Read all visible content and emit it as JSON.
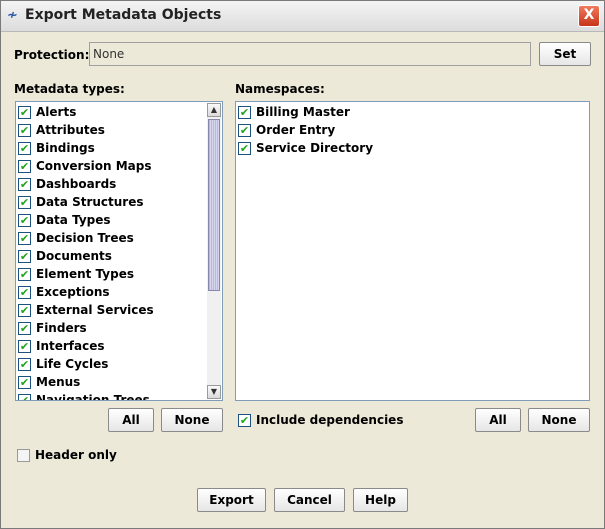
{
  "window": {
    "title": "Export Metadata Objects",
    "close_glyph": "X"
  },
  "protection": {
    "label": "Protection:",
    "value": "None",
    "set_label": "Set"
  },
  "metadata_types": {
    "label": "Metadata types:",
    "items": [
      {
        "label": "Alerts",
        "checked": true
      },
      {
        "label": "Attributes",
        "checked": true
      },
      {
        "label": "Bindings",
        "checked": true
      },
      {
        "label": "Conversion Maps",
        "checked": true
      },
      {
        "label": "Dashboards",
        "checked": true
      },
      {
        "label": "Data Structures",
        "checked": true
      },
      {
        "label": "Data Types",
        "checked": true
      },
      {
        "label": "Decision Trees",
        "checked": true
      },
      {
        "label": "Documents",
        "checked": true
      },
      {
        "label": "Element Types",
        "checked": true
      },
      {
        "label": "Exceptions",
        "checked": true
      },
      {
        "label": "External Services",
        "checked": true
      },
      {
        "label": "Finders",
        "checked": true
      },
      {
        "label": "Interfaces",
        "checked": true
      },
      {
        "label": "Life Cycles",
        "checked": true
      },
      {
        "label": "Menus",
        "checked": true
      },
      {
        "label": "Navigation Trees",
        "checked": true
      }
    ],
    "all_label": "All",
    "none_label": "None"
  },
  "namespaces": {
    "label": "Namespaces:",
    "items": [
      {
        "label": "Billing Master",
        "checked": true
      },
      {
        "label": "Order Entry",
        "checked": true
      },
      {
        "label": "Service Directory",
        "checked": true
      }
    ],
    "include_dependencies": {
      "label": "Include dependencies",
      "checked": true
    },
    "all_label": "All",
    "none_label": "None"
  },
  "header_only": {
    "label": "Header only",
    "checked": false
  },
  "footer": {
    "export_label": "Export",
    "cancel_label": "Cancel",
    "help_label": "Help"
  },
  "glyphs": {
    "check": "✔",
    "up": "▲",
    "down": "▼",
    "title_icon": "≁"
  }
}
